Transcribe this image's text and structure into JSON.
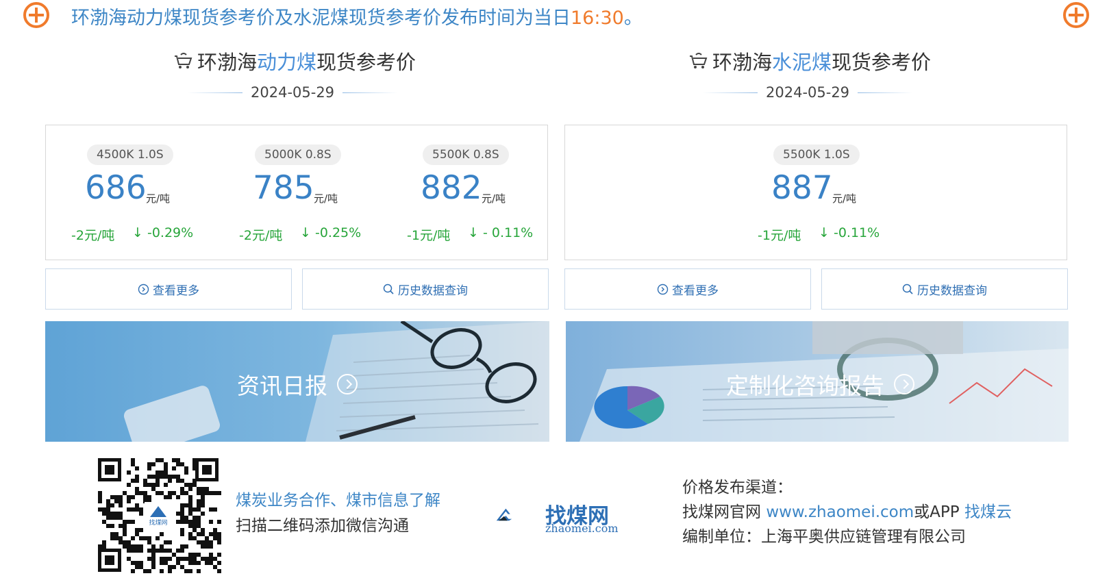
{
  "banner": {
    "text": "环渤海动力煤现货参考价及水泥煤现货参考价发布时间为当日",
    "time": "16:30",
    "suffix": "。",
    "accent_color": "#f07b2c"
  },
  "thermal": {
    "title_prefix": "环渤海",
    "title_highlight": "动力煤",
    "title_suffix": "现货参考价",
    "date": "2024-05-29",
    "items": [
      {
        "spec": "4500K 1.0S",
        "price": "686",
        "unit": "元/吨",
        "change": "-2元/吨",
        "pct": "↓ -0.29%"
      },
      {
        "spec": "5000K 0.8S",
        "price": "785",
        "unit": "元/吨",
        "change": "-2元/吨",
        "pct": "↓ -0.25%"
      },
      {
        "spec": "5500K 0.8S",
        "price": "882",
        "unit": "元/吨",
        "change": "-1元/吨",
        "pct": "↓ - 0.11%"
      }
    ],
    "more_label": "查看更多",
    "history_label": "历史数据查询"
  },
  "cement": {
    "title_prefix": "环渤海",
    "title_highlight": "水泥煤",
    "title_suffix": "现货参考价",
    "date": "2024-05-29",
    "items": [
      {
        "spec": "5500K 1.0S",
        "price": "887",
        "unit": "元/吨",
        "change": "-1元/吨",
        "pct": "↓ -0.11%"
      }
    ],
    "more_label": "查看更多",
    "history_label": "历史数据查询"
  },
  "promo": {
    "left_label": "资讯日报",
    "right_label": "定制化咨询报告"
  },
  "footer": {
    "contact_line1": "煤炭业务合作、煤市信息了解",
    "contact_line2": "扫描二维码添加微信沟通",
    "logo_text": "找煤网",
    "logo_sub": "zhaomei.com",
    "qr_logo_text": "找煤网",
    "channel_title": "价格发布渠道：",
    "channel_line2_prefix": "找煤网官网 ",
    "channel_site": "www.zhaomei.com",
    "channel_mid": "或APP ",
    "channel_app": "找煤云",
    "channel_line3": "编制单位：上海平奥供应链管理有限公司"
  },
  "colors": {
    "price_blue": "#3a82c6",
    "down_green": "#27a53a",
    "link_blue": "#3d86c6"
  },
  "icons": [
    "plus-circle-icon",
    "cart-icon",
    "arrow-circle-icon",
    "search-icon",
    "qr-code",
    "zhaomei-logo"
  ]
}
